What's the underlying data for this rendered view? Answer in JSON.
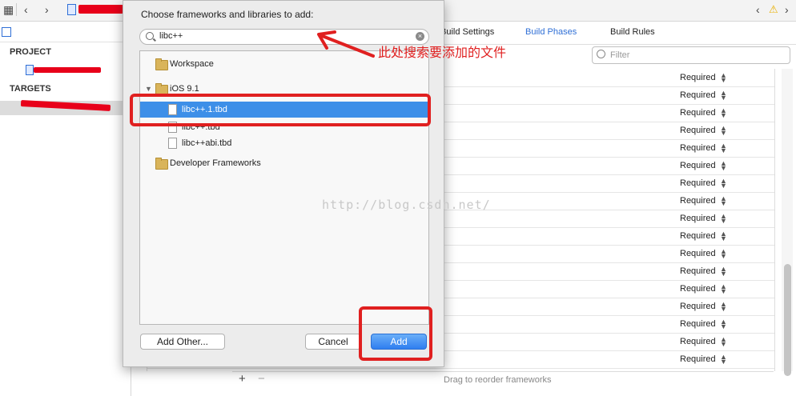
{
  "dialog": {
    "title": "Choose frameworks and libraries to add:",
    "search_value": "libc++",
    "tree": [
      {
        "label": "Workspace",
        "type": "folder"
      },
      {
        "label": "iOS 9.1",
        "type": "folder",
        "expanded": true
      },
      {
        "label": "libc++.1.tbd",
        "type": "file",
        "selected": true
      },
      {
        "label": "libc++.tbd",
        "type": "file"
      },
      {
        "label": "libc++abi.tbd",
        "type": "file"
      },
      {
        "label": "Developer Frameworks",
        "type": "folder"
      }
    ],
    "add_other_label": "Add Other...",
    "cancel_label": "Cancel",
    "add_label": "Add"
  },
  "navigator": {
    "project_header": "PROJECT",
    "targets_header": "TARGETS"
  },
  "editor": {
    "tabs": [
      "Build Settings",
      "Build Phases",
      "Build Rules"
    ],
    "active_tab": "Build Phases",
    "filter_placeholder": "Filter",
    "row_status": [
      "Required",
      "Required",
      "Required",
      "Required",
      "Required",
      "Required",
      "Required",
      "Required",
      "Required",
      "Required",
      "Required",
      "Required",
      "Required",
      "Required",
      "Required",
      "Required",
      "Required"
    ],
    "add_symbol": "+",
    "remove_symbol": "−",
    "drag_hint": "Drag to reorder frameworks"
  },
  "annotation": {
    "text": "此处搜索要添加的文件",
    "watermark": "http://blog.csdn.net/"
  },
  "colors": {
    "accent": "#3d8fe8",
    "annotation_red": "#e02020",
    "folder": "#d9b45a"
  }
}
